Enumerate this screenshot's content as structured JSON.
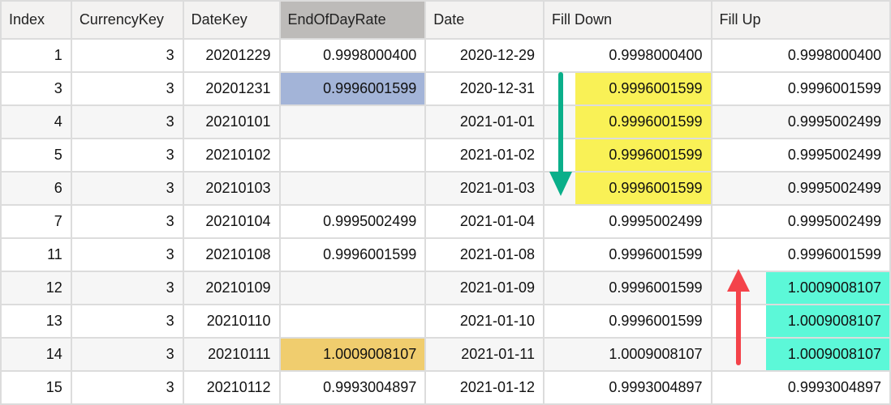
{
  "columns": [
    "Index",
    "CurrencyKey",
    "DateKey",
    "EndOfDayRate",
    "Date",
    "Fill Down",
    "Fill Up"
  ],
  "selected_column": "EndOfDayRate",
  "rows": [
    {
      "index": "1",
      "currency": "3",
      "datekey": "20201229",
      "eod": "0.9998000400",
      "date": "2020-12-29",
      "filldown": "0.9998000400",
      "fillup": "0.9998000400"
    },
    {
      "index": "3",
      "currency": "3",
      "datekey": "20201231",
      "eod": "0.9996001599",
      "date": "2020-12-31",
      "filldown": "0.9996001599",
      "fillup": "0.9996001599"
    },
    {
      "index": "4",
      "currency": "3",
      "datekey": "20210101",
      "eod": "",
      "date": "2021-01-01",
      "filldown": "0.9996001599",
      "fillup": "0.9995002499"
    },
    {
      "index": "5",
      "currency": "3",
      "datekey": "20210102",
      "eod": "",
      "date": "2021-01-02",
      "filldown": "0.9996001599",
      "fillup": "0.9995002499"
    },
    {
      "index": "6",
      "currency": "3",
      "datekey": "20210103",
      "eod": "",
      "date": "2021-01-03",
      "filldown": "0.9996001599",
      "fillup": "0.9995002499"
    },
    {
      "index": "7",
      "currency": "3",
      "datekey": "20210104",
      "eod": "0.9995002499",
      "date": "2021-01-04",
      "filldown": "0.9995002499",
      "fillup": "0.9995002499"
    },
    {
      "index": "11",
      "currency": "3",
      "datekey": "20210108",
      "eod": "0.9996001599",
      "date": "2021-01-08",
      "filldown": "0.9996001599",
      "fillup": "0.9996001599"
    },
    {
      "index": "12",
      "currency": "3",
      "datekey": "20210109",
      "eod": "",
      "date": "2021-01-09",
      "filldown": "0.9996001599",
      "fillup": "1.0009008107"
    },
    {
      "index": "13",
      "currency": "3",
      "datekey": "20210110",
      "eod": "",
      "date": "2021-01-10",
      "filldown": "0.9996001599",
      "fillup": "1.0009008107"
    },
    {
      "index": "14",
      "currency": "3",
      "datekey": "20210111",
      "eod": "1.0009008107",
      "date": "2021-01-11",
      "filldown": "1.0009008107",
      "fillup": "1.0009008107"
    },
    {
      "index": "15",
      "currency": "3",
      "datekey": "20210112",
      "eod": "0.9993004897",
      "date": "2021-01-12",
      "filldown": "0.9993004897",
      "fillup": "0.9993004897"
    }
  ],
  "colors": {
    "fill_down_highlight": "#f9f156",
    "fill_up_highlight": "#5cf8d8",
    "source_blue": "#a3b4d8",
    "source_orange": "#f0cd6e",
    "arrow_down": "#0aaf8a",
    "arrow_up": "#f4434a"
  }
}
